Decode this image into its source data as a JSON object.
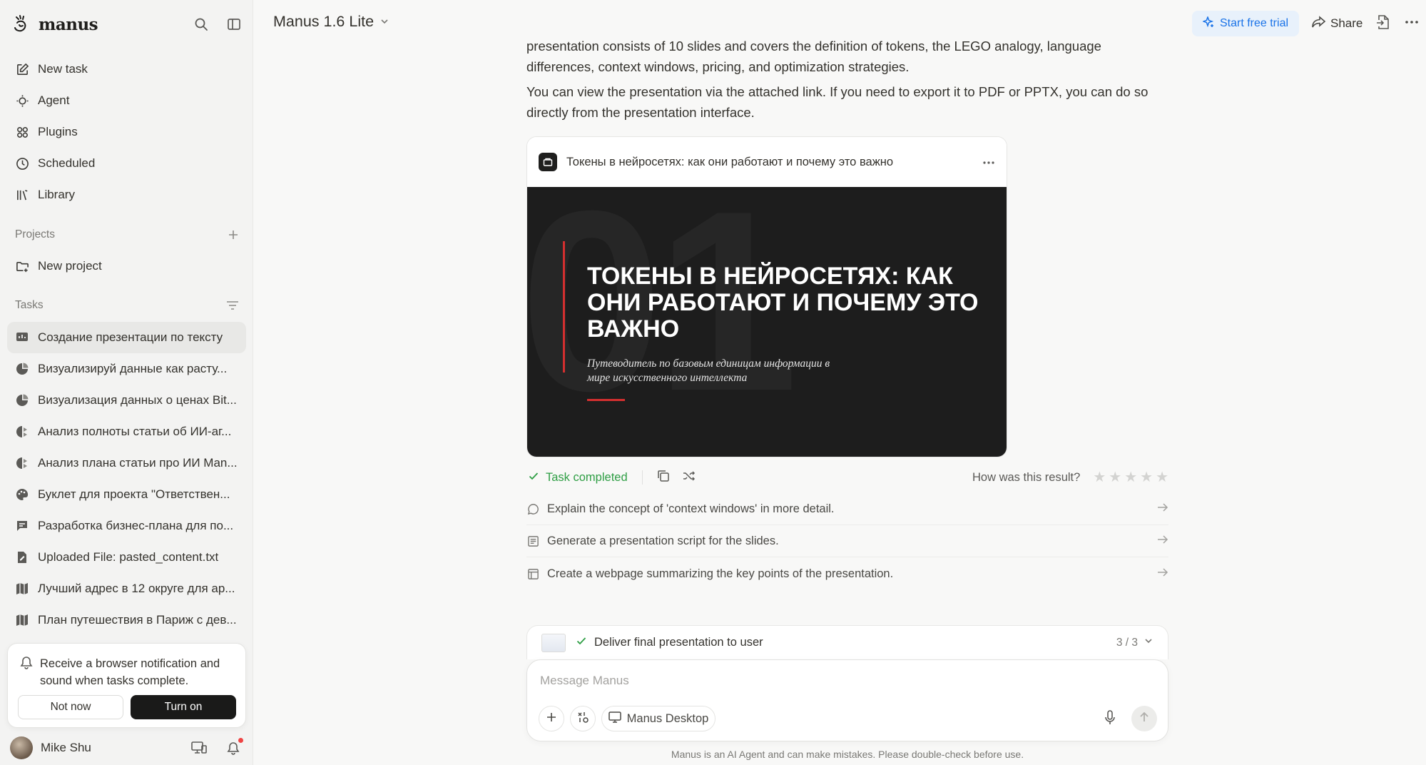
{
  "app": {
    "name": "manus"
  },
  "sidebar": {
    "nav": [
      {
        "label": "New task",
        "icon": "edit-icon"
      },
      {
        "label": "Agent",
        "icon": "agent-icon"
      },
      {
        "label": "Plugins",
        "icon": "plugins-icon"
      },
      {
        "label": "Scheduled",
        "icon": "clock-icon"
      },
      {
        "label": "Library",
        "icon": "library-icon"
      }
    ],
    "projects_heading": "Projects",
    "new_project": "New project",
    "tasks_heading": "Tasks",
    "tasks": [
      {
        "label": "Создание презентации по тексту",
        "active": true
      },
      {
        "label": "Визуализируй данные как расту..."
      },
      {
        "label": "Визуализация данных о ценах Bit..."
      },
      {
        "label": "Анализ полноты статьи об ИИ-аг..."
      },
      {
        "label": "Анализ плана статьи про ИИ Man..."
      },
      {
        "label": "Буклет для проекта \"Ответствен..."
      },
      {
        "label": "Разработка бизнес-плана для по..."
      },
      {
        "label": "Uploaded File: pasted_content.txt"
      },
      {
        "label": "Лучший адрес в 12 округе для ар..."
      },
      {
        "label": "План путешествия в Париж с дев..."
      }
    ],
    "notification": {
      "text": "Receive a browser notification and sound when tasks complete.",
      "not_now": "Not now",
      "turn_on": "Turn on"
    },
    "user": {
      "name": "Mike Shu"
    }
  },
  "header": {
    "model": "Manus 1.6 Lite",
    "trial": "Start free trial",
    "share": "Share"
  },
  "chat": {
    "para1_line1": "presentation consists of 10 slides and covers the definition of tokens, the LEGO analogy, language",
    "para1_line2": "differences, context windows, pricing, and optimization strategies.",
    "para2": "You can view the presentation via the attached link. If you need to export it to PDF or PPTX, you can do so directly from the presentation interface.",
    "presentation": {
      "title": "Токены в нейросетях: как они работают и почему это важно",
      "slide_number": "01",
      "slide_title": "ТОКЕНЫ В НЕЙРОСЕТЯХ: КАК ОНИ РАБОТАЮТ И ПОЧЕМУ ЭТО ВАЖНО",
      "slide_subtitle": "Путеводитель по базовым единицам информации в мире искусственного интеллекта"
    },
    "status": "Task completed",
    "rating_prompt": "How was this result?",
    "suggestions": [
      {
        "label": "Explain the concept of 'context windows' in more detail.",
        "icon": "chat-bubble-icon"
      },
      {
        "label": "Generate a presentation script for the slides.",
        "icon": "script-icon"
      },
      {
        "label": "Create a webpage summarizing the key points of the presentation.",
        "icon": "webpage-icon"
      }
    ],
    "plan": {
      "step": "Deliver final presentation to user",
      "progress": "3 / 3"
    },
    "composer": {
      "placeholder": "Message Manus",
      "desktop": "Manus Desktop"
    },
    "disclaimer": "Manus is an AI Agent and can make mistakes. Please double-check before use."
  }
}
